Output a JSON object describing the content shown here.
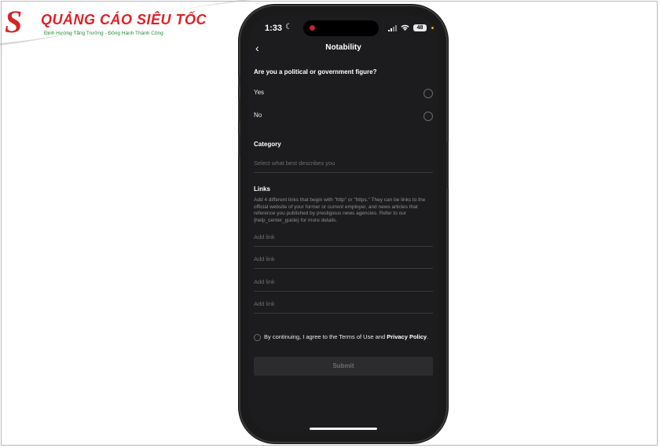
{
  "brand": {
    "logo_letter": "S",
    "name_part1": "QUẢNG CÁO ",
    "name_part2": "SIÊU TỐC",
    "tagline": "Định Hướng Tăng Trưởng - Đồng Hành Thành Công",
    "colors": {
      "red": "#e01f26",
      "green": "#2a8a3a"
    }
  },
  "status_bar": {
    "time": "1:33",
    "battery": "48",
    "icons": [
      "moon-icon",
      "signal-icon",
      "wifi-icon",
      "battery-icon"
    ]
  },
  "nav": {
    "title": "Notability",
    "back_icon": "chevron-left-icon"
  },
  "question": {
    "title": "Are you a political or government figure?",
    "options": [
      "Yes",
      "No"
    ]
  },
  "category": {
    "label": "Category",
    "placeholder": "Select what best describes you"
  },
  "links": {
    "label": "Links",
    "description": "Add 4 different links that begin with \"http\" or \"https.\" They can be links to the official website of your former or current employer, and news articles that reference you published by prestigious news agencies. Refer to our {help_center_guide} for more details.",
    "placeholders": [
      "Add link",
      "Add link",
      "Add link",
      "Add link"
    ]
  },
  "agreement": {
    "text": "By continuing, I agree to the Terms of Use and ",
    "bold": "Privacy Policy",
    "end": "."
  },
  "submit_label": "Submit",
  "colors": {
    "screen_bg": "#1c1c1e",
    "text": "#f2f2f2",
    "muted": "#6d6d70",
    "divider": "#3a3a3c",
    "record_dot": "#c0262c"
  }
}
